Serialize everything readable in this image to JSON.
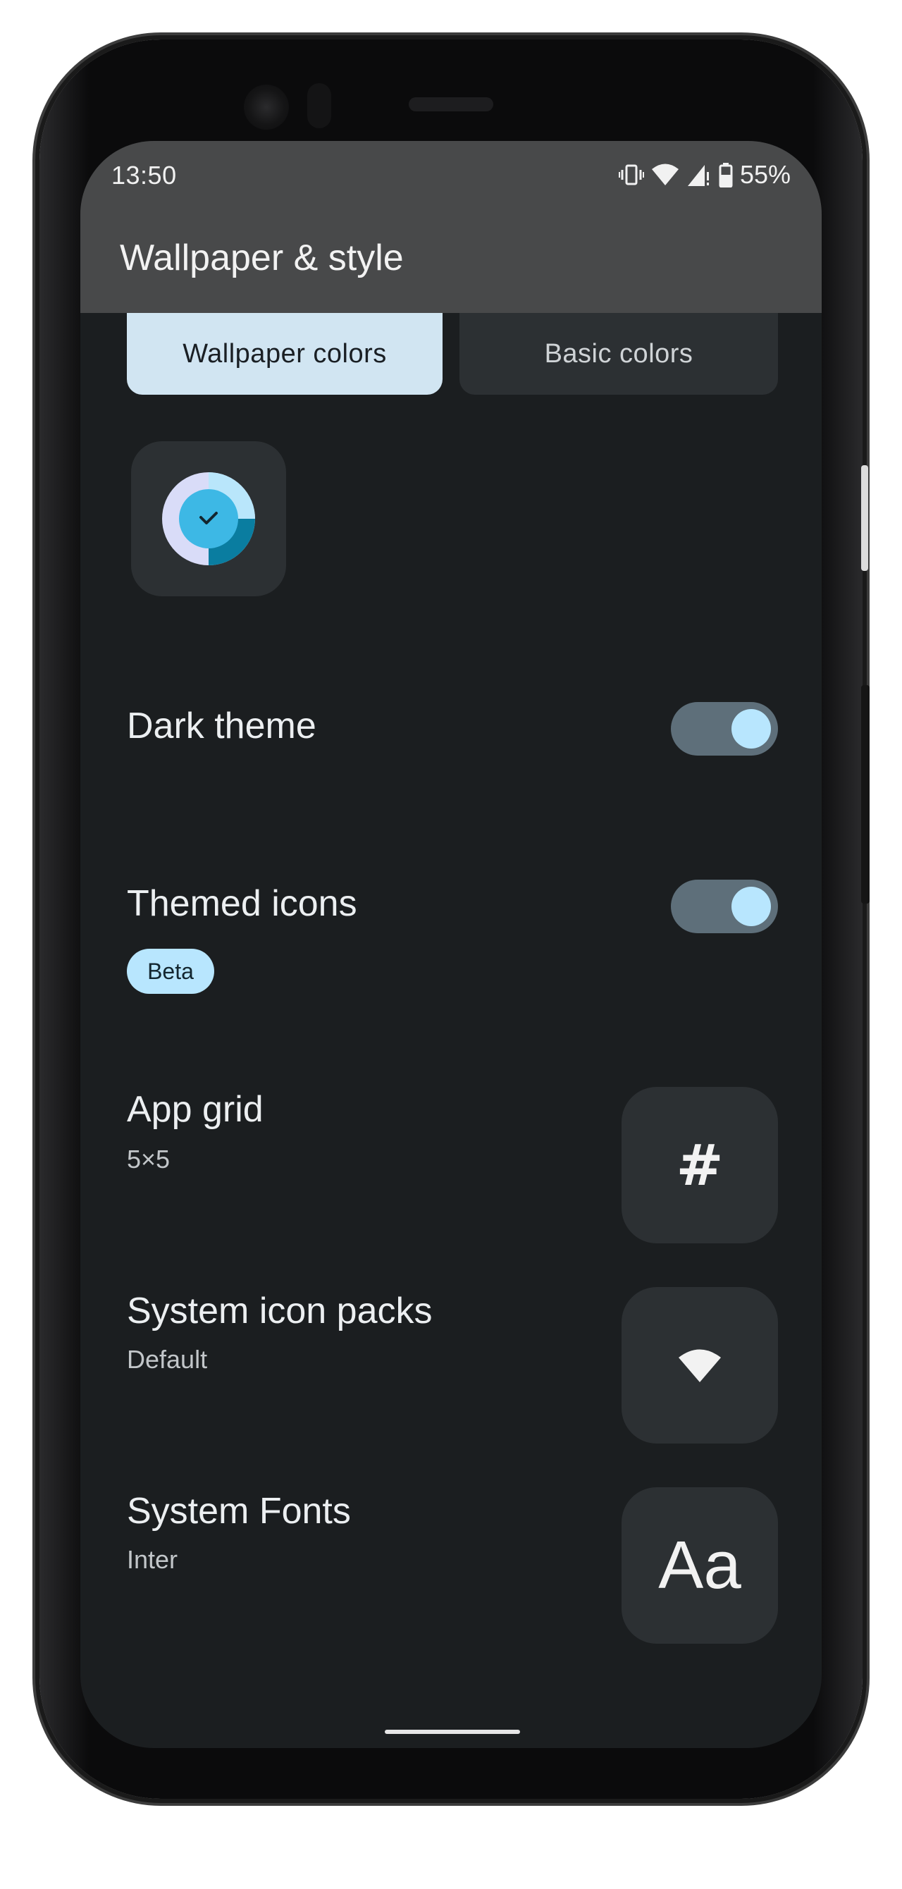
{
  "status_bar": {
    "time": "13:50",
    "battery": "55%",
    "icons": [
      "vibrate-icon",
      "wifi-icon",
      "signal-icon",
      "battery-icon"
    ]
  },
  "app_bar": {
    "title": "Wallpaper & style"
  },
  "tabs": [
    {
      "label": "Wallpaper colors",
      "selected": true
    },
    {
      "label": "Basic colors",
      "selected": false
    }
  ],
  "color_option": {
    "selected": true,
    "colors": [
      "#3db8e5",
      "#d9dcf8",
      "#0a7da0",
      "#b9e6fb"
    ],
    "icon": "check-icon"
  },
  "settings": {
    "dark_theme": {
      "label": "Dark theme",
      "enabled": true
    },
    "themed_icons": {
      "label": "Themed icons",
      "badge": "Beta",
      "enabled": true
    },
    "app_grid": {
      "label": "App grid",
      "value": "5×5",
      "icon": "grid-icon",
      "glyph": "#"
    },
    "icon_packs": {
      "label": "System icon packs",
      "value": "Default",
      "icon": "wifi-icon"
    },
    "fonts": {
      "label": "System Fonts",
      "value": "Inter",
      "icon": "font-icon",
      "glyph": "Aa"
    }
  },
  "theme": {
    "surface": "#1b1e20",
    "card": "#2c3033",
    "accent": "#b8e6fe",
    "toggle_track": "#5e6f7a",
    "tab_selected": "#d1e5f2",
    "app_bar": "#48494a"
  }
}
